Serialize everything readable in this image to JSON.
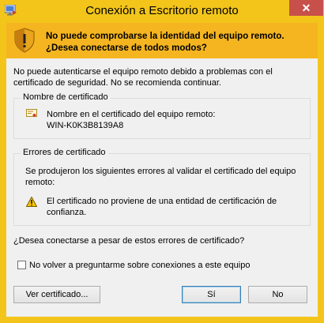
{
  "window": {
    "title": "Conexión a Escritorio remoto",
    "close_label": "✕"
  },
  "warning": {
    "headline": "No puede comprobarse la identidad del equipo remoto. ¿Desea conectarse de todos modos?"
  },
  "intro": "No puede autenticarse el equipo remoto debido a problemas con el certificado de seguridad. No se recomienda continuar.",
  "cert_name_group": {
    "legend": "Nombre de certificado",
    "label": "Nombre en el certificado del equipo remoto:",
    "value": "WIN-K0K3B8139A8"
  },
  "cert_errors_group": {
    "legend": "Errores de certificado",
    "description": "Se produjeron los siguientes errores al validar el certificado del equipo remoto:",
    "error": "El certificado no proviene de una entidad de certificación de confianza."
  },
  "question": "¿Desea conectarse a pesar de estos errores de certificado?",
  "checkbox": {
    "label": "No volver a preguntarme sobre conexiones a este equipo",
    "checked": false
  },
  "buttons": {
    "view_cert": "Ver certificado...",
    "yes": "Sí",
    "no": "No"
  },
  "colors": {
    "frame": "#f3c51b",
    "warning_band": "#f5b520",
    "content_bg": "#f0f0f0",
    "close_button": "#c7504b"
  }
}
